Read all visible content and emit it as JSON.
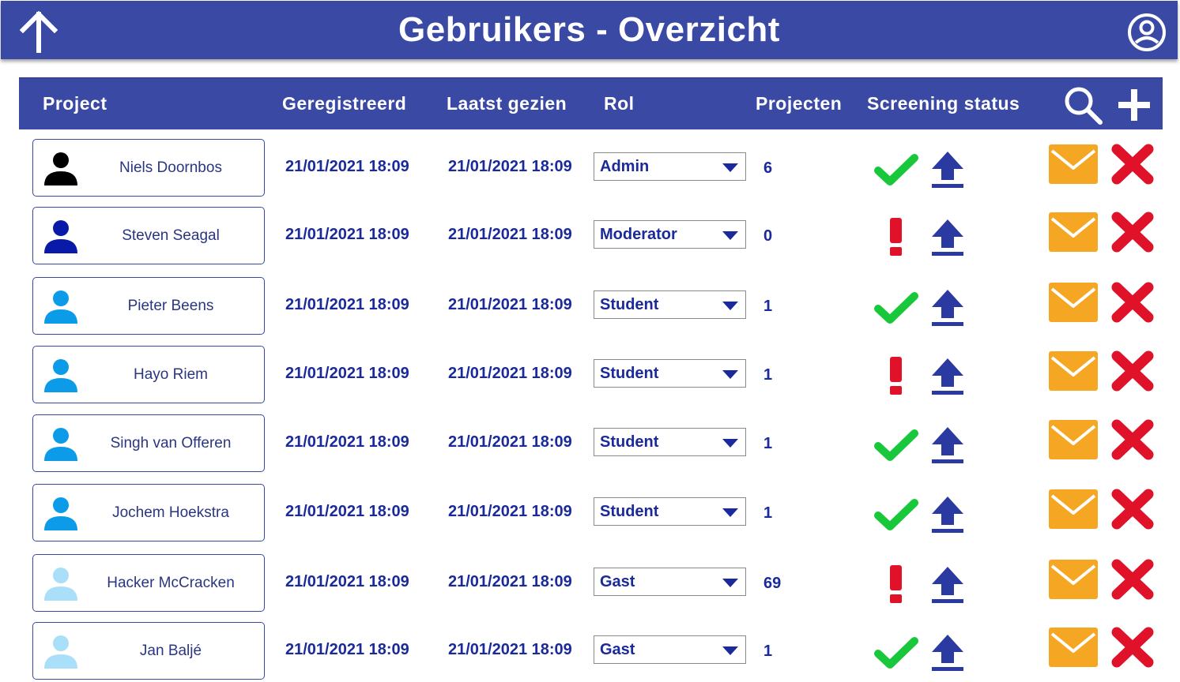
{
  "header": {
    "title": "Gebruikers - Overzicht",
    "back_icon": "arrow-up-icon",
    "account_icon": "account-circle-icon",
    "bar_color": "#3a49a3"
  },
  "columns": {
    "project": "Project",
    "registered": "Geregistreerd",
    "last_seen": "Laatst gezien",
    "role": "Rol",
    "projects": "Projecten",
    "screening": "Screening status",
    "search_icon": "search-icon",
    "add_icon": "plus-icon"
  },
  "colors": {
    "admin": "#000000",
    "moderator": "#0a1aa8",
    "student": "#0b9be8",
    "guest": "#a9dff8",
    "ok": "#18c83a",
    "warning": "#e0122a",
    "mail": "#f5a623",
    "delete": "#e0122a"
  },
  "users": [
    {
      "name": "Niels Doornbos",
      "registered": "21/01/2021 18:09",
      "last_seen": "21/01/2021 18:09",
      "role": "Admin",
      "projects": "6",
      "screening": "ok",
      "avatar_color": "#000000"
    },
    {
      "name": "Steven Seagal",
      "registered": "21/01/2021 18:09",
      "last_seen": "21/01/2021 18:09",
      "role": "Moderator",
      "projects": "0",
      "screening": "warning",
      "avatar_color": "#0a1aa8"
    },
    {
      "name": "Pieter Beens",
      "registered": "21/01/2021 18:09",
      "last_seen": "21/01/2021 18:09",
      "role": "Student",
      "projects": "1",
      "screening": "ok",
      "avatar_color": "#0b9be8"
    },
    {
      "name": "Hayo Riem",
      "registered": "21/01/2021 18:09",
      "last_seen": "21/01/2021 18:09",
      "role": "Student",
      "projects": "1",
      "screening": "warning",
      "avatar_color": "#0b9be8"
    },
    {
      "name": "Singh van Offeren",
      "registered": "21/01/2021 18:09",
      "last_seen": "21/01/2021 18:09",
      "role": "Student",
      "projects": "1",
      "screening": "ok",
      "avatar_color": "#0b9be8"
    },
    {
      "name": "Jochem Hoekstra",
      "registered": "21/01/2021 18:09",
      "last_seen": "21/01/2021 18:09",
      "role": "Student",
      "projects": "1",
      "screening": "ok",
      "avatar_color": "#0b9be8"
    },
    {
      "name": "Hacker McCracken",
      "registered": "21/01/2021 18:09",
      "last_seen": "21/01/2021 18:09",
      "role": "Gast",
      "projects": "69",
      "screening": "warning",
      "avatar_color": "#a9dff8"
    },
    {
      "name": "Jan Baljé",
      "registered": "21/01/2021 18:09",
      "last_seen": "21/01/2021 18:09",
      "role": "Gast",
      "projects": "1",
      "screening": "ok",
      "avatar_color": "#a9dff8"
    }
  ]
}
